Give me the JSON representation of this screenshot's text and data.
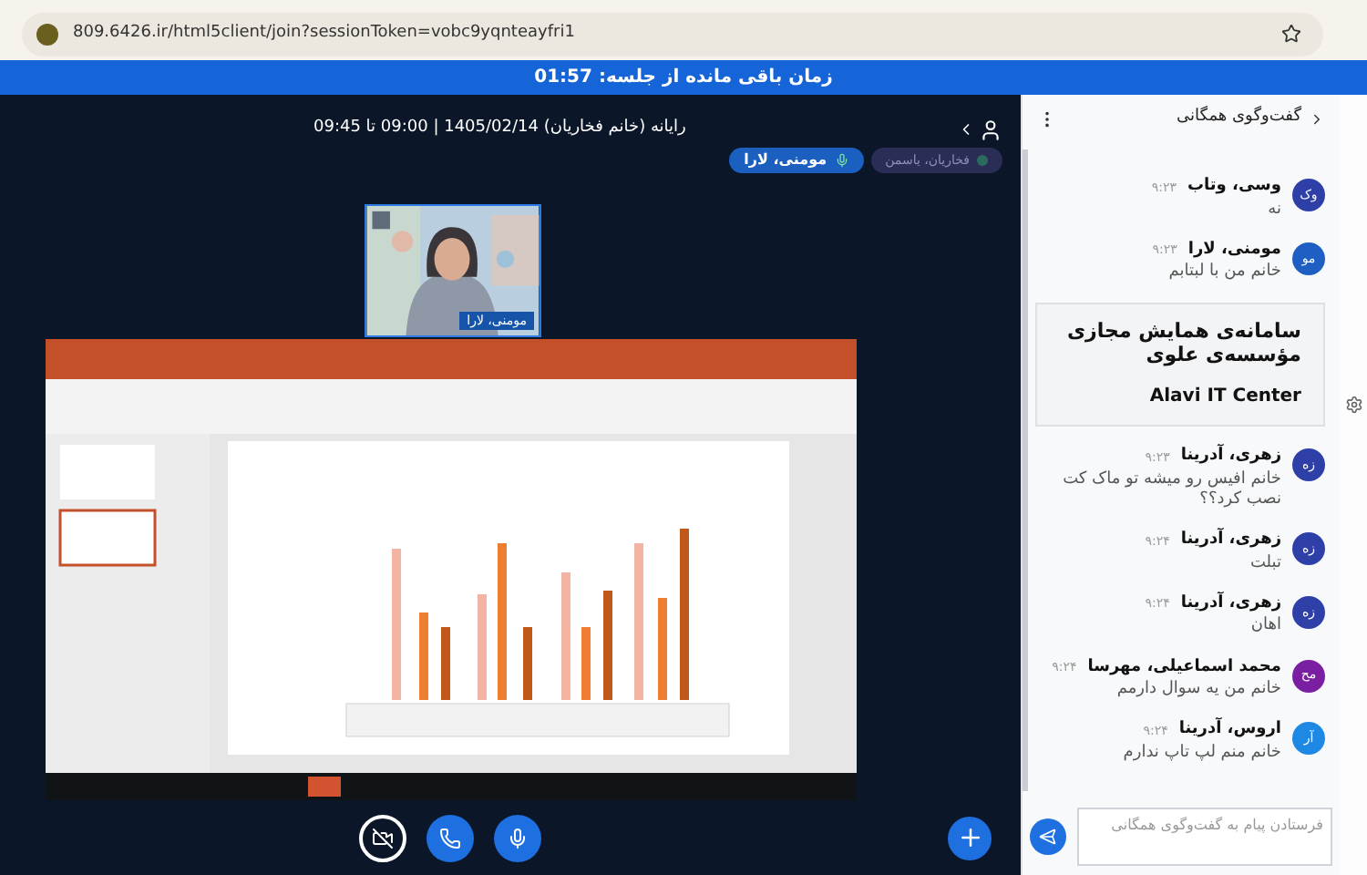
{
  "browser": {
    "url": "809.6426.ir/html5client/join?sessionToken=vobc9yqnteayfri1"
  },
  "banner": {
    "text": "زمان باقی مانده از جلسه: 01:57"
  },
  "meeting": {
    "title": "رایانه (خانم فخاریان) 1405/02/14 | 09:00 تا 09:45"
  },
  "talkers": [
    {
      "name": "فخاریان، یاسمن",
      "talking": false
    },
    {
      "name": "مومنی، لارا",
      "talking": true
    }
  ],
  "webcam": {
    "name": "مومنی، لارا"
  },
  "controls": [
    {
      "kind": "camera",
      "active": false
    },
    {
      "kind": "phone",
      "active": true
    },
    {
      "kind": "mic",
      "active": true
    }
  ],
  "chat": {
    "title": "گفت‌وگوی همگانی",
    "messages": [
      {
        "kind": "message",
        "initials": "وک",
        "color": "#2f3fa8",
        "name": "وسی، وتاب",
        "time": "۹:۲۳",
        "text": "نه"
      },
      {
        "kind": "message",
        "initials": "مو",
        "color": "#1f5fc4",
        "name": "مومنی، لارا",
        "time": "۹:۲۳",
        "text": "خانم من با لبتابم"
      },
      {
        "kind": "welcome",
        "title": "سامانه‌ی همایش مجازی مؤسسه‌ی علوی",
        "subtitle": "Alavi IT Center"
      },
      {
        "kind": "message",
        "initials": "زه",
        "color": "#2f3fa8",
        "name": "زهری، آدرینا",
        "time": "۹:۲۳",
        "text": "خانم افیس رو میشه تو ماک کت نصب کرد؟؟"
      },
      {
        "kind": "message",
        "initials": "زه",
        "color": "#2f3fa8",
        "name": "زهری، آدرینا",
        "time": "۹:۲۴",
        "text": "تبلت"
      },
      {
        "kind": "message",
        "initials": "زه",
        "color": "#2f3fa8",
        "name": "زهری، آدرینا",
        "time": "۹:۲۴",
        "text": "اهان"
      },
      {
        "kind": "message",
        "initials": "مح",
        "color": "#7b1fa2",
        "name": "محمد اسماعیلی، مهرسا",
        "time": "۹:۲۴",
        "text": "خانم من یه سوال دارمم"
      },
      {
        "kind": "message",
        "initials": "آر",
        "color": "#1e88e5",
        "name": "اروس، آدرینا",
        "time": "۹:۲۴",
        "text": "خانم منم لپ تاپ ندارم"
      }
    ],
    "input": {
      "placeholder": "فرستادن پیام به گفت‌وگوی همگانی"
    }
  }
}
